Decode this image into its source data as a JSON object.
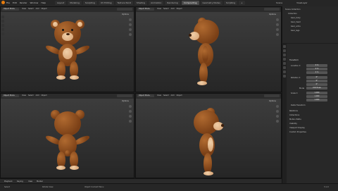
{
  "app": {
    "menu": [
      "File",
      "Edit",
      "Render",
      "Window",
      "Help"
    ]
  },
  "workspace_tabs": [
    "Layout",
    "Modeling",
    "Sculpting",
    "UV Editing",
    "Texture Paint",
    "Shading",
    "Animation",
    "Rendering",
    "Compositing",
    "Geometry Nodes",
    "Scripting",
    "+"
  ],
  "active_tab_index": 8,
  "top_right": {
    "scene": "Scene",
    "view_layer": "ViewLayer"
  },
  "viewports": [
    {
      "mode": "Object Mode",
      "menus": [
        "View",
        "Select",
        "Add",
        "Object"
      ],
      "options": "Options"
    },
    {
      "mode": "Object Mode",
      "menus": [
        "View",
        "Select",
        "Add",
        "Object"
      ],
      "options": "Options"
    },
    {
      "mode": "Object Mode",
      "menus": [
        "View",
        "Select",
        "Add",
        "Object"
      ],
      "options": "Options"
    },
    {
      "mode": "Object Mode",
      "menus": [
        "View",
        "Select",
        "Add",
        "Object"
      ],
      "options": "Options"
    }
  ],
  "outliner": {
    "root": "Scene Collection",
    "items": [
      "Collection",
      "bear_body",
      "bear_head",
      "bear_arms",
      "bear_legs"
    ]
  },
  "properties": {
    "section": "Transform",
    "location_label": "Location X",
    "location": [
      "0 m",
      "0 m",
      "0 m"
    ],
    "rotation_label": "Rotation X",
    "rotation": [
      "0°",
      "0°",
      "0°"
    ],
    "mode_label": "Mode",
    "mode_value": "XYZ Euler",
    "scale_label": "Scale X",
    "scale": [
      "1.000",
      "1.000",
      "1.000"
    ],
    "delta": "Delta Transform",
    "panels": [
      "Relations",
      "Collections",
      "Motion Paths",
      "Visibility",
      "Viewport Display",
      "Custom Properties"
    ]
  },
  "timeline": {
    "items": [
      "Playback",
      "Keying",
      "View",
      "Marker"
    ]
  },
  "status": {
    "select": "Select",
    "rotate": "Rotate View",
    "context": "Object Context Menu",
    "version": "3.1.0"
  }
}
